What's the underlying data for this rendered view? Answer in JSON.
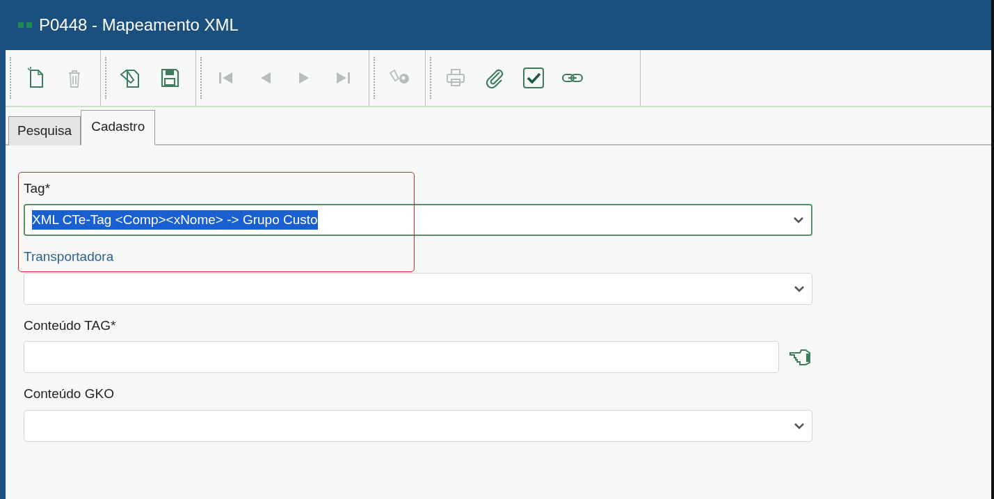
{
  "window": {
    "title": "P0448 - Mapeamento XML"
  },
  "toolbar": [
    [
      {
        "kind": "new",
        "disabled": false
      },
      {
        "kind": "delete",
        "disabled": true
      }
    ],
    [
      {
        "kind": "edit",
        "disabled": false
      },
      {
        "kind": "save",
        "disabled": false
      }
    ],
    [
      {
        "kind": "first",
        "disabled": true
      },
      {
        "kind": "previous",
        "disabled": true
      },
      {
        "kind": "next",
        "disabled": true
      },
      {
        "kind": "last",
        "disabled": true
      }
    ],
    [
      {
        "kind": "lookup",
        "disabled": true
      }
    ],
    [
      {
        "kind": "print",
        "disabled": true
      },
      {
        "kind": "attach",
        "disabled": false
      },
      {
        "kind": "confirm",
        "disabled": false
      },
      {
        "kind": "link",
        "disabled": false
      }
    ]
  ],
  "tabs": [
    {
      "label": "Pesquisa",
      "selected": false
    },
    {
      "label": "Cadastro",
      "selected": true
    }
  ],
  "fields": [
    {
      "label": "Tag*",
      "kind": "select",
      "value": "XML CTe-Tag <Comp><xNome> -> Grupo Custo",
      "focused": true,
      "text_selected": true,
      "highlighted": true
    },
    {
      "label": "Transportadora",
      "kind": "select",
      "focused": false,
      "label_link": true
    },
    {
      "label": "Conteúdo TAG*",
      "kind": "text",
      "focused": false
    },
    {
      "label": "Conteúdo GKO",
      "kind": "select",
      "focused": false
    }
  ]
}
